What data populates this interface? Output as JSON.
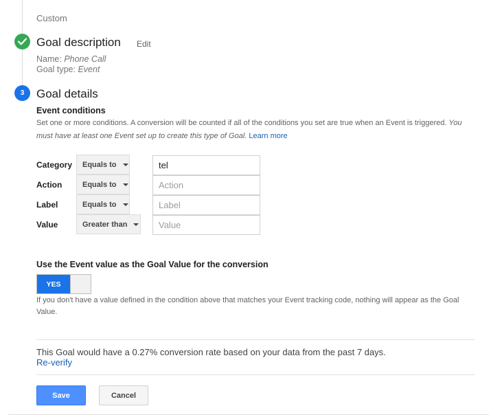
{
  "step1": {
    "value": "Custom"
  },
  "goal_description": {
    "title": "Goal description",
    "edit_label": "Edit",
    "name_label": "Name:",
    "name_value": "Phone Call",
    "type_label": "Goal type:",
    "type_value": "Event"
  },
  "goal_details": {
    "step_number": "3",
    "title": "Goal details",
    "event_conditions": {
      "title": "Event conditions",
      "desc_plain": "Set one or more conditions. A conversion will be counted if all of the conditions you set are true when an Event is triggered.",
      "desc_italic": "You must have at least one Event set up to create this type of Goal.",
      "learn_more": "Learn more"
    },
    "conditions": [
      {
        "label": "Category",
        "operator": "Equals to",
        "value": "tel",
        "placeholder": "Category"
      },
      {
        "label": "Action",
        "operator": "Equals to",
        "value": "",
        "placeholder": "Action"
      },
      {
        "label": "Label",
        "operator": "Equals to",
        "value": "",
        "placeholder": "Label"
      },
      {
        "label": "Value",
        "operator": "Greater than",
        "value": "",
        "placeholder": "Value"
      }
    ],
    "use_event_value": {
      "title": "Use the Event value as the Goal Value for the conversion",
      "toggle_label": "YES",
      "toggle_state": "on",
      "description": "If you don't have a value defined in the condition above that matches your Event tracking code, nothing will appear as the Goal Value."
    },
    "verification": {
      "text": "This Goal would have a 0.27% conversion rate based on your data from the past 7 days.",
      "reverify_label": "Re-verify"
    },
    "buttons": {
      "save": "Save",
      "cancel": "Cancel"
    }
  },
  "colors": {
    "check_green": "#34a853",
    "step_blue": "#1a73e8",
    "link_blue": "#1a5fb4",
    "save_blue": "#4d90fe"
  }
}
